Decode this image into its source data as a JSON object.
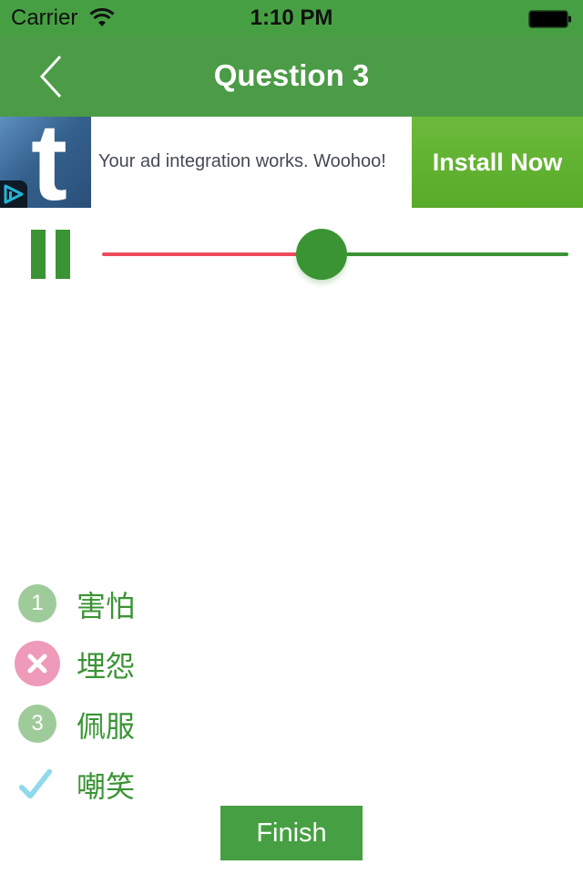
{
  "status_bar": {
    "carrier": "Carrier",
    "time": "1:10 PM",
    "wifi_icon": "wifi-icon",
    "battery_icon": "battery-full-icon"
  },
  "nav": {
    "title": "Question 3",
    "back_icon": "chevron-left-icon"
  },
  "ad": {
    "app_icon_letter": "t",
    "text": "Your ad integration works. Woohoo!",
    "cta": "Install Now"
  },
  "player": {
    "state": "playing",
    "control_icon": "pause-icon",
    "progress": 0.47,
    "colors": {
      "played": "#ef4a5e",
      "remaining": "#3a9434",
      "thumb": "#3a9434"
    }
  },
  "answers": [
    {
      "marker_type": "number",
      "marker": "1",
      "text": "害怕"
    },
    {
      "marker_type": "wrong",
      "marker": "x-icon",
      "text": "埋怨"
    },
    {
      "marker_type": "number",
      "marker": "3",
      "text": "佩服"
    },
    {
      "marker_type": "correct",
      "marker": "checkmark-icon",
      "text": "嘲笑"
    }
  ],
  "finish_label": "Finish",
  "colors": {
    "brand_green": "#46a043",
    "answer_text": "#3a9434",
    "wrong_marker": "#ee9ab8",
    "correct_marker": "#8fd9ec",
    "number_marker": "#9fcb9a"
  }
}
